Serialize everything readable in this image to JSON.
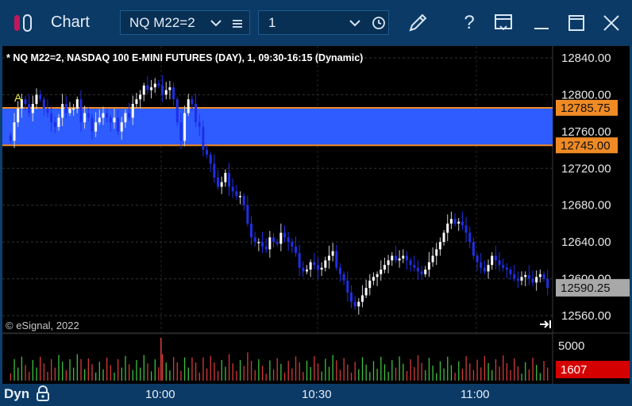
{
  "window": {
    "title": "Chart",
    "symbol_value": "NQ M22=2",
    "interval_value": "1",
    "colors": {
      "titlebar": "#0b3a66",
      "accent_pink": "#c2185b"
    }
  },
  "chart": {
    "header": "* NQ M22=2, NASDAQ 100 E-MINI FUTURES (DAY), 1, 09:30-16:15 (Dynamic)",
    "watermark": "© eSignal, 2022",
    "marker_label": "A",
    "price_ticks": [
      "12840.00",
      "12800.00",
      "12760.00",
      "12720.00",
      "12680.00",
      "12640.00",
      "12600.00",
      "12560.00"
    ],
    "zone_top_label": "12785.75",
    "zone_bottom_label": "12745.00",
    "last_price_label": "12590.25",
    "volume_tick": "5000",
    "volume_last": "1607",
    "time_ticks": [
      "10:00",
      "10:30",
      "11:00"
    ],
    "dyn_label": "Dyn",
    "colors": {
      "zone_fill": "#2e5cff",
      "zone_line": "#f08a24",
      "down_candle": "#1f2fe6",
      "up_candle": "#ffffff",
      "volume_up": "#3fbf3f",
      "volume_down": "#d43a3a",
      "last_price_bg": "#a8a8a8",
      "volume_last_bg": "#d40000"
    }
  },
  "chart_data": {
    "type": "candlestick",
    "y_range": [
      12550,
      12860
    ],
    "zone": {
      "top": 12785.75,
      "bottom": 12745.0
    },
    "last_price": 12590.25,
    "closes": [
      12750,
      12770,
      12785,
      12795,
      12790,
      12780,
      12790,
      12800,
      12795,
      12785,
      12780,
      12770,
      12765,
      12775,
      12790,
      12780,
      12785,
      12785,
      12795,
      12770,
      12780,
      12775,
      12760,
      12770,
      12775,
      12780,
      12775,
      12770,
      12775,
      12760,
      12770,
      12780,
      12775,
      12790,
      12795,
      12800,
      12810,
      12805,
      12808,
      12812,
      12810,
      12800,
      12805,
      12808,
      12795,
      12770,
      12750,
      12780,
      12795,
      12790,
      12770,
      12765,
      12740,
      12735,
      12725,
      12710,
      12700,
      12705,
      12715,
      12700,
      12695,
      12690,
      12690,
      12680,
      12660,
      12645,
      12640,
      12640,
      12635,
      12632,
      12645,
      12640,
      12638,
      12650,
      12645,
      12640,
      12635,
      12628,
      12612,
      12608,
      12610,
      12618,
      12615,
      12610,
      12612,
      12620,
      12625,
      12630,
      12612,
      12605,
      12598,
      12585,
      12575,
      12570,
      12575,
      12582,
      12590,
      12598,
      12602,
      12605,
      12610,
      12615,
      12620,
      12625,
      12620,
      12622,
      12625,
      12620,
      12615,
      12612,
      12608,
      12605,
      12610,
      12618,
      12625,
      12632,
      12640,
      12650,
      12660,
      12665,
      12660,
      12662,
      12658,
      12650,
      12640,
      12625,
      12618,
      12612,
      12608,
      12615,
      12625,
      12620,
      12615,
      12612,
      12610,
      12605,
      12600,
      12598,
      12602,
      12604,
      12600,
      12596,
      12602,
      12605,
      12600,
      12590
    ],
    "volume_max": 5000,
    "volume_last": 1607
  }
}
